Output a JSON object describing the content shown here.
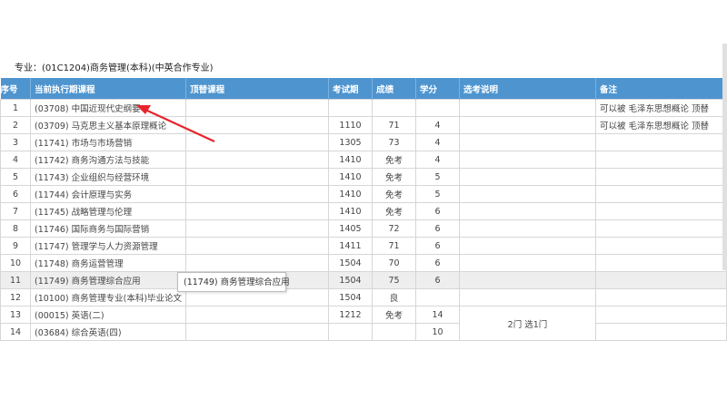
{
  "major_label": "专业：(01C1204)商务管理(本科)(中英合作专业)",
  "headers": {
    "no": "序号",
    "course": "当前执行期课程",
    "substitute": "顶替课程",
    "exam_period": "考试期",
    "score": "成绩",
    "credit": "学分",
    "exam_note": "选考说明",
    "remark": "备注"
  },
  "rows": [
    {
      "no": "1",
      "course": "(03708) 中国近现代史纲要",
      "substitute": "",
      "exam_period": "",
      "score": "",
      "credit": "",
      "exam_note": "",
      "remark": "可以被 毛泽东思想概论 顶替"
    },
    {
      "no": "2",
      "course": "(03709) 马克思主义基本原理概论",
      "substitute": "",
      "exam_period": "1110",
      "score": "71",
      "credit": "4",
      "exam_note": "",
      "remark": "可以被 毛泽东思想概论 顶替"
    },
    {
      "no": "3",
      "course": "(11741) 市场与市场营销",
      "substitute": "",
      "exam_period": "1305",
      "score": "73",
      "credit": "4",
      "exam_note": "",
      "remark": ""
    },
    {
      "no": "4",
      "course": "(11742) 商务沟通方法与技能",
      "substitute": "",
      "exam_period": "1410",
      "score": "免考",
      "credit": "4",
      "exam_note": "",
      "remark": ""
    },
    {
      "no": "5",
      "course": "(11743) 企业组织与经营环境",
      "substitute": "",
      "exam_period": "1410",
      "score": "免考",
      "credit": "5",
      "exam_note": "",
      "remark": ""
    },
    {
      "no": "6",
      "course": "(11744) 会计原理与实务",
      "substitute": "",
      "exam_period": "1410",
      "score": "免考",
      "credit": "5",
      "exam_note": "",
      "remark": ""
    },
    {
      "no": "7",
      "course": "(11745) 战略管理与伦理",
      "substitute": "",
      "exam_period": "1410",
      "score": "免考",
      "credit": "6",
      "exam_note": "",
      "remark": ""
    },
    {
      "no": "8",
      "course": "(11746) 国际商务与国际营销",
      "substitute": "",
      "exam_period": "1405",
      "score": "72",
      "credit": "6",
      "exam_note": "",
      "remark": ""
    },
    {
      "no": "9",
      "course": "(11747) 管理学与人力资源管理",
      "substitute": "",
      "exam_period": "1411",
      "score": "71",
      "credit": "6",
      "exam_note": "",
      "remark": ""
    },
    {
      "no": "10",
      "course": "(11748) 商务运营管理",
      "substitute": "",
      "exam_period": "1504",
      "score": "70",
      "credit": "6",
      "exam_note": "",
      "remark": ""
    },
    {
      "no": "11",
      "course": "(11749) 商务管理综合应用",
      "substitute": "",
      "exam_period": "1504",
      "score": "75",
      "credit": "6",
      "exam_note": "",
      "remark": ""
    },
    {
      "no": "12",
      "course": "(10100) 商务管理专业(本科)毕业论文",
      "substitute": "",
      "exam_period": "1504",
      "score": "良",
      "credit": "",
      "exam_note": "",
      "remark": ""
    },
    {
      "no": "13",
      "course": "(00015) 英语(二)",
      "substitute": "",
      "exam_period": "1212",
      "score": "免考",
      "credit": "14",
      "exam_note": "2门 选1门",
      "remark": ""
    },
    {
      "no": "14",
      "course": "(03684) 综合英语(四)",
      "substitute": "",
      "exam_period": "",
      "score": "",
      "credit": "10",
      "exam_note": "",
      "remark": ""
    }
  ],
  "tooltip": "(11749) 商务管理综合应用",
  "colors": {
    "header_bg": "#4e95d0",
    "highlight_text": "#e8802a",
    "arrow": "#e8242b"
  }
}
